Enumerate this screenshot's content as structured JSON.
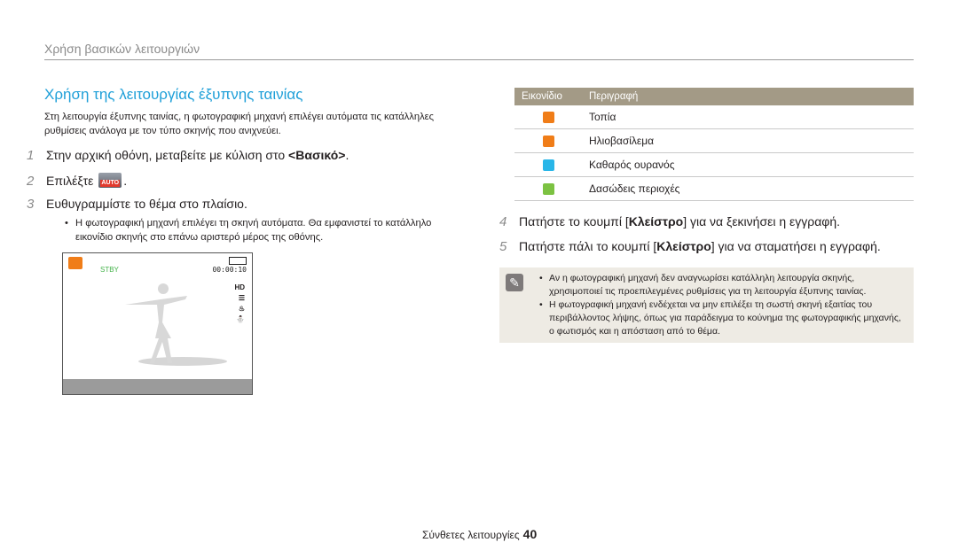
{
  "section_header": "Χρήση βασικών λειτουργιών",
  "title": "Χρήση της λειτουργίας έξυπνης ταινίας",
  "intro": "Στη λειτουργία έξυπνης ταινίας, η φωτογραφική μηχανή επιλέγει αυτόματα τις κατάλληλες ρυθμίσεις ανάλογα με τον τύπο σκηνής που ανιχνεύει.",
  "steps": [
    {
      "num": "1",
      "pre": "Στην αρχική οθόνη, μεταβείτε με κύλιση στο ",
      "bold": "<Βασικό>",
      "post": "."
    },
    {
      "num": "2",
      "pre": "Επιλέξτε ",
      "icon_label": "AUTO",
      "post": "."
    },
    {
      "num": "3",
      "text": "Ευθυγραμμίστε το θέμα στο πλαίσιο."
    },
    {
      "num": "4",
      "pre": "Πατήστε το κουμπί [",
      "bold": "Κλείστρο",
      "post": "] για να ξεκινήσει η εγγραφή."
    },
    {
      "num": "5",
      "pre": "Πατήστε πάλι το κουμπί [",
      "bold": "Κλείστρο",
      "post": "] για να σταματήσει η εγγραφή."
    }
  ],
  "step3_bullet": "Η φωτογραφική μηχανή επιλέγει τη σκηνή αυτόματα. Θα εμφανιστεί το κατάλληλο εικονίδιο σκηνής στο επάνω αριστερό μέρος της οθόνης.",
  "camera_screen": {
    "rec_label": "STBY",
    "time": "00:00:10",
    "side_icons": [
      "HD",
      "☰",
      "♨",
      "⛄"
    ]
  },
  "table": {
    "headers": [
      "Εικονίδιο",
      "Περιγραφή"
    ],
    "rows": [
      {
        "icon": "landscape-icon",
        "color": "#f07d18",
        "label": "Τοπία"
      },
      {
        "icon": "sunset-icon",
        "color": "#f07d18",
        "label": "Ηλιοβασίλεμα"
      },
      {
        "icon": "clear-sky-icon",
        "color": "#29b6e8",
        "label": "Καθαρός ουρανός"
      },
      {
        "icon": "forest-icon",
        "color": "#7cc242",
        "label": "Δασώδεις περιοχές"
      }
    ]
  },
  "note": {
    "items": [
      "Αν η φωτογραφική μηχανή δεν αναγνωρίσει κατάλληλη λειτουργία σκηνής, χρησιμοποιεί τις προεπιλεγμένες ρυθμίσεις για τη λειτουργία έξυπνης ταινίας.",
      "Η φωτογραφική μηχανή ενδέχεται να μην επιλέξει τη σωστή σκηνή εξαιτίας του περιβάλλοντος λήψης, όπως για παράδειγμα το κούνημα της φωτογραφικής μηχανής, ο φωτισμός και η απόσταση από το θέμα."
    ]
  },
  "footer": {
    "section": "Σύνθετες λειτουργίες",
    "page": "40"
  },
  "colors": {
    "accent": "#1e9fd8",
    "table_header": "#a39a86",
    "note_bg": "#eeebe4"
  }
}
